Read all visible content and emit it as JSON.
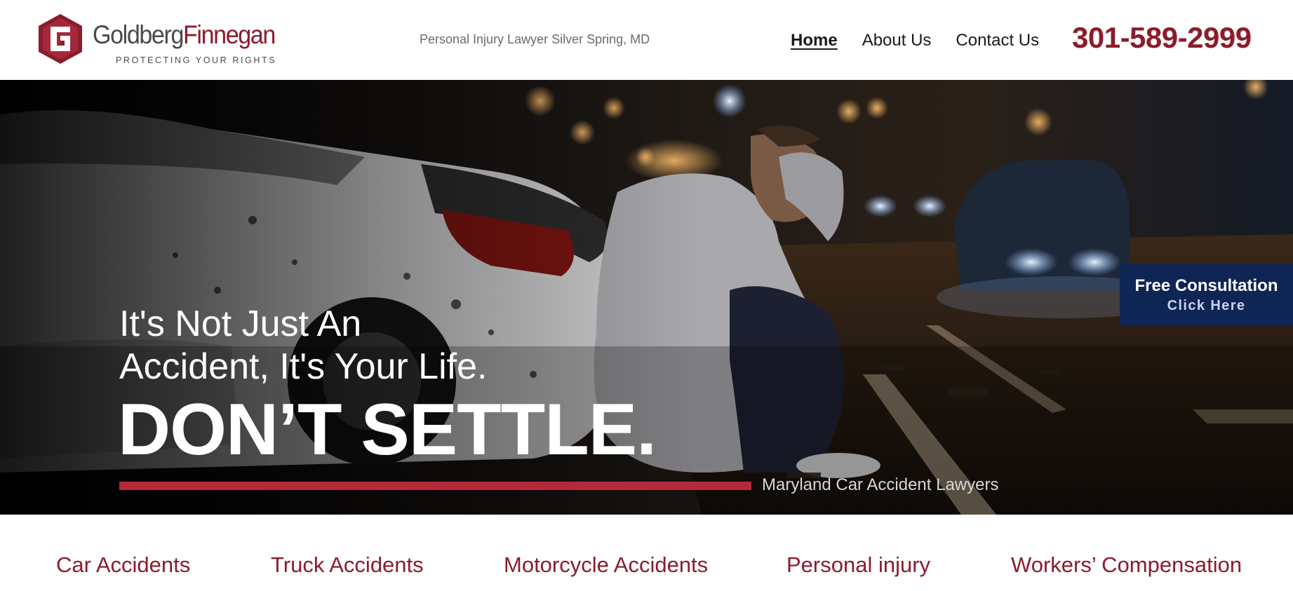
{
  "header": {
    "logo": {
      "name_part1": "Goldberg",
      "name_part2": "Finnegan",
      "tagline": "PROTECTING YOUR RIGHTS",
      "mark_letter": "G"
    },
    "tagline": "Personal Injury Lawyer Silver Spring, MD",
    "nav": [
      {
        "label": "Home",
        "active": true
      },
      {
        "label": "About Us",
        "active": false
      },
      {
        "label": "Contact Us",
        "active": false
      }
    ],
    "phone": "301-589-2999"
  },
  "hero": {
    "line1": "It's Not Just An",
    "line2": "Accident, It's Your Life.",
    "headline": "DON’T SETTLE.",
    "subtext": "Maryland Car Accident Lawyers"
  },
  "consultation": {
    "title": "Free Consultation",
    "subtitle": "Click Here"
  },
  "practice_areas": [
    {
      "label": "Car Accidents"
    },
    {
      "label": "Truck Accidents"
    },
    {
      "label": "Motorcycle Accidents"
    },
    {
      "label": "Personal injury"
    },
    {
      "label": "Workers’ Compensation"
    }
  ],
  "colors": {
    "brand_red": "#8b1c2c",
    "accent_bar": "#b52a3a",
    "consult_navy": "#0f2554"
  }
}
